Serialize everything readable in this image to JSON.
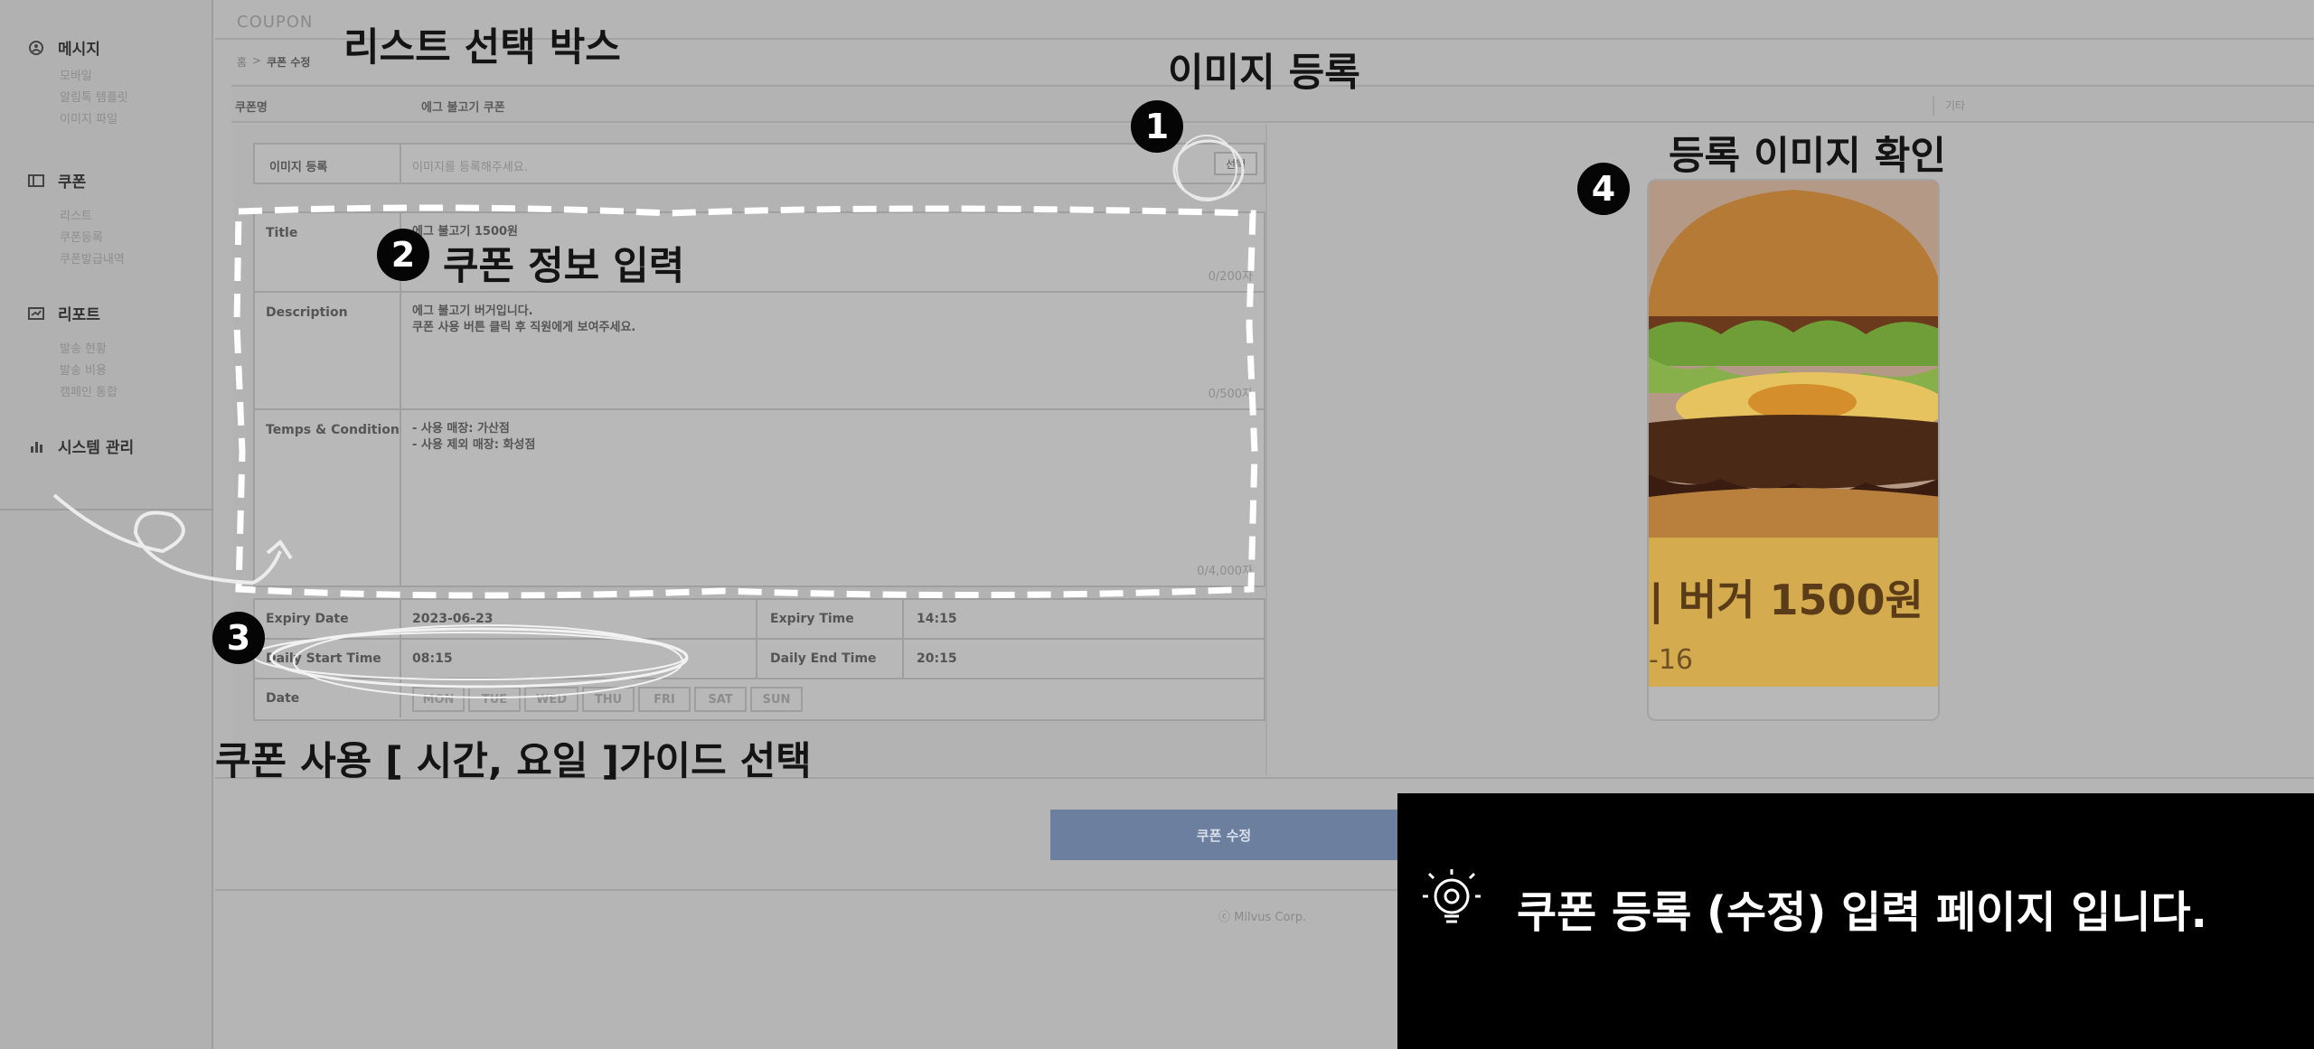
{
  "sidebar": {
    "groups": [
      {
        "label": "메시지",
        "icon": "message-circle-icon",
        "items": [
          "모바일",
          "알림톡 템플릿",
          "이미지 파일"
        ]
      },
      {
        "label": "쿠폰",
        "icon": "coupon-box-icon",
        "items": [
          "리스트",
          "쿠폰등록",
          "쿠폰발급내역"
        ]
      },
      {
        "label": "리포트",
        "icon": "report-icon",
        "items": [
          "발송 현황",
          "발송 비용",
          "캠페인 통합"
        ]
      },
      {
        "label": "시스템 관리",
        "icon": "bar-chart-icon",
        "items": []
      }
    ]
  },
  "header": {
    "title": "COUPON",
    "breadcrumb_home": "홈",
    "breadcrumb_sep": ">",
    "breadcrumb_current": "쿠폰 수정"
  },
  "coupon_name": {
    "label": "쿠폰명",
    "value": "에그 불고기 쿠폰",
    "extra": "기타"
  },
  "image_upload": {
    "label": "이미지 등록",
    "placeholder": "이미지를 등록해주세요.",
    "button": "선택"
  },
  "info": {
    "title": {
      "label": "Title",
      "value": "에그 불고기 1500원",
      "counter": "0/200자"
    },
    "description": {
      "label": "Description",
      "line1": "에그 불고기 버거입니다.",
      "line2": "쿠폰 사용 버튼 클릭 후 직원에게 보여주세요.",
      "counter": "0/500자"
    },
    "terms": {
      "label": "Temps & Condition",
      "line1": "- 사용 매장: 가산점",
      "line2": "- 사용 제외 매장: 화성점",
      "counter": "0/4,000자"
    }
  },
  "time": {
    "expiry_date_label": "Expiry Date",
    "expiry_date": "2023-06-23",
    "expiry_time_label": "Expiry Time",
    "expiry_time": "14:15",
    "daily_start_label": "Daily Start Time",
    "daily_start": "08:15",
    "daily_end_label": "Daily End Time",
    "daily_end": "20:15",
    "date_label": "Date",
    "days": [
      "MON",
      "TUE",
      "WED",
      "THU",
      "FRI",
      "SAT",
      "SUN"
    ]
  },
  "submit_button": "쿠폰 수정",
  "footer": "ⓒ Milvus Corp.",
  "preview": {
    "price_text": "| 버거 1500원",
    "sub_text": "-16"
  },
  "annotations": {
    "list_select": "리스트 선택 박스",
    "image_register": "이미지 등록",
    "coupon_info": "쿠폰 정보 입력",
    "guide": "쿠폰 사용 [ 시간, 요일 ]가이드 선택",
    "preview_check": "등록 이미지 확인",
    "badges": [
      "1",
      "2",
      "3",
      "4"
    ],
    "info_message": "쿠폰 등록 (수정) 입력 페이지 입니다."
  },
  "colors": {
    "overlay_gray": "#b5b5b5",
    "submit_blue": "#6c7f9f",
    "callout_black": "#000000"
  }
}
